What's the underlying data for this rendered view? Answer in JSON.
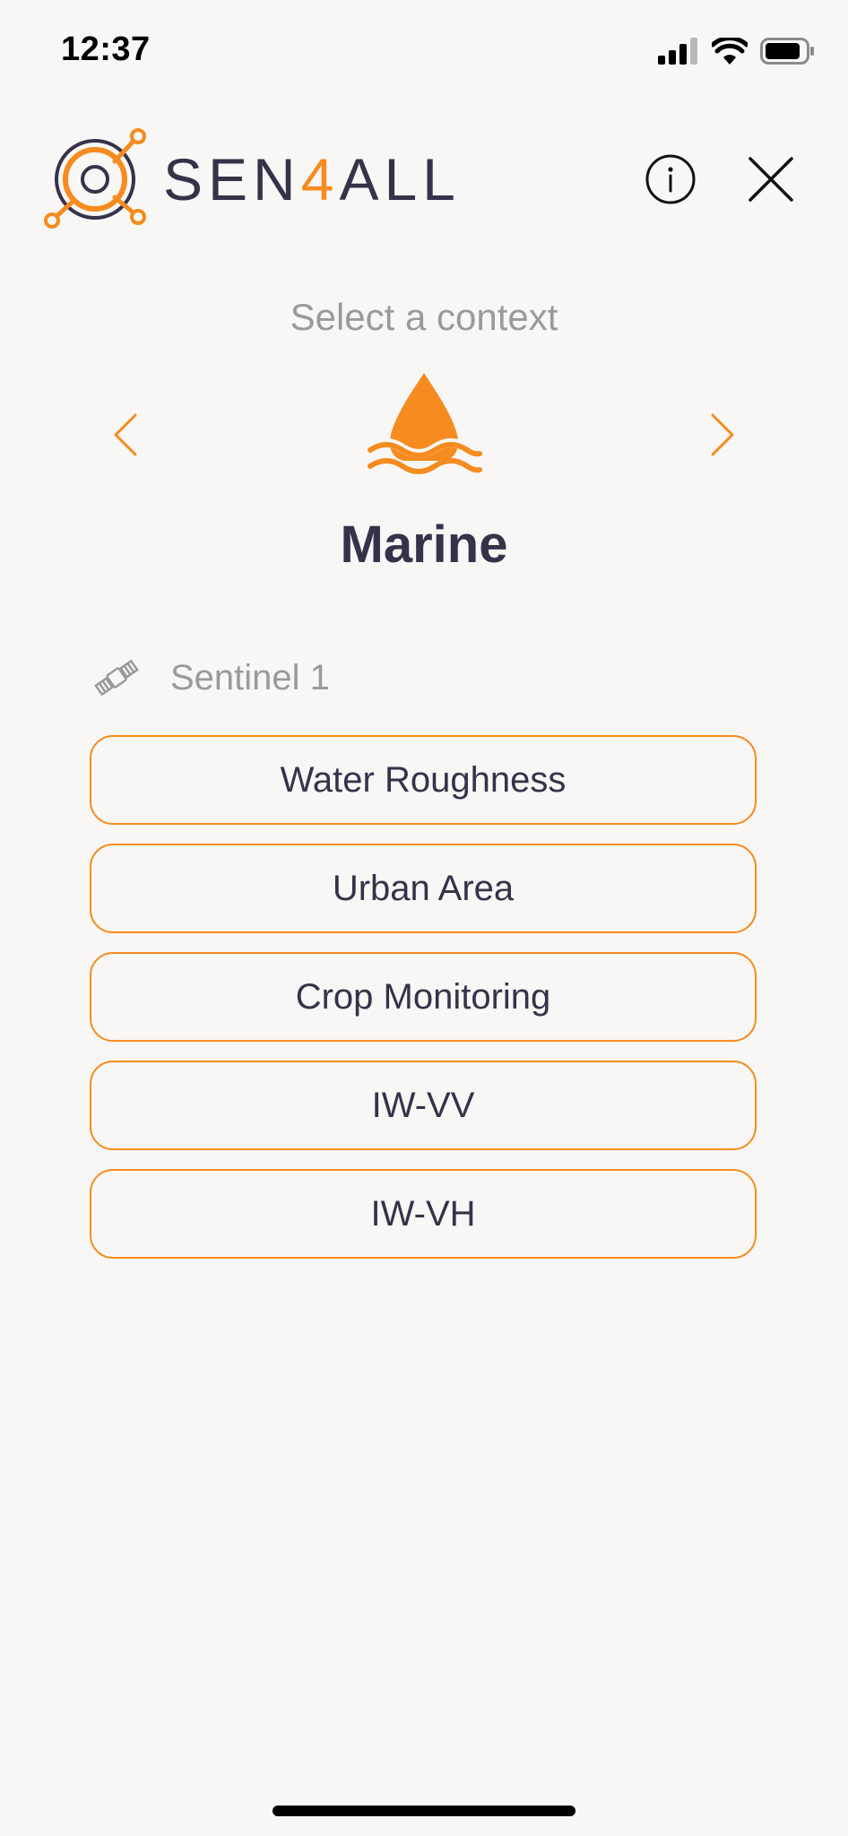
{
  "status_bar": {
    "time": "12:37"
  },
  "header": {
    "logo_prefix": "SEN",
    "logo_accent": "4",
    "logo_suffix": "ALL"
  },
  "context_selector": {
    "title": "Select a context",
    "current_context": "Marine",
    "icon": "water-drop-icon"
  },
  "sensor": {
    "icon": "satellite-icon",
    "label": "Sentinel 1"
  },
  "options": [
    {
      "label": "Water Roughness"
    },
    {
      "label": "Urban Area"
    },
    {
      "label": "Crop Monitoring"
    },
    {
      "label": "IW-VV"
    },
    {
      "label": "IW-VH"
    }
  ],
  "colors": {
    "accent": "#f68b1f",
    "text_dark": "#36324a",
    "text_muted": "#9a9a9a",
    "background": "#f8f7f5"
  }
}
